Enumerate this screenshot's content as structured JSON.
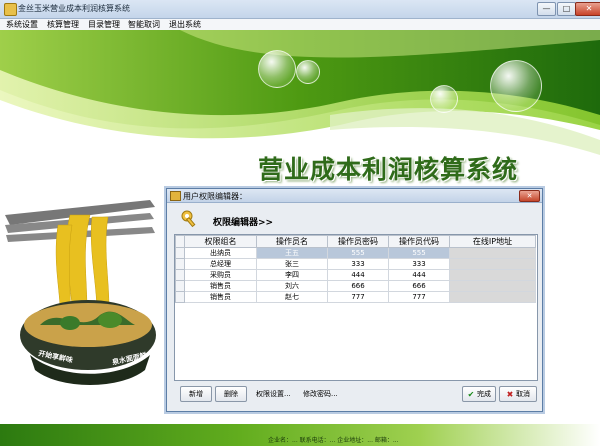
{
  "window": {
    "title": "金丝玉米营业成本利润核算系统",
    "minimize_glyph": "—",
    "maximize_glyph": "□",
    "close_glyph": "✕"
  },
  "menu": [
    "系统设置",
    "核算管理",
    "目录管理",
    "智能取词",
    "退出系统"
  ],
  "banner": {
    "title": "营业成本利润核算系统",
    "bowl_text_left": "开始享鲜味",
    "bowl_text_right": "泉水面面鲜"
  },
  "dialog": {
    "title": "用户权限编辑器：",
    "close_glyph": "✕",
    "editor_label": "权限编辑器>>",
    "columns": [
      "权限组名",
      "操作员名",
      "操作员密码",
      "操作员代码",
      "在线IP地址"
    ],
    "rows": [
      [
        "出纳员",
        "王五",
        "555",
        "555",
        ""
      ],
      [
        "总经理",
        "张三",
        "333",
        "333",
        ""
      ],
      [
        "采购员",
        "李四",
        "444",
        "444",
        ""
      ],
      [
        "销售员",
        "刘六",
        "666",
        "666",
        ""
      ],
      [
        "销售员",
        "赵七",
        "777",
        "777",
        ""
      ]
    ],
    "buttons": {
      "add": "新增",
      "delete": "删除",
      "permission_settings": "权限设置...",
      "change_password": "修改密码...",
      "done": "完成",
      "cancel": "取消"
    }
  },
  "status": {
    "text": "企业名：...  联系电话：...  企业地址：...  邮箱：..."
  },
  "colors": {
    "title_green": "#2f6b1a",
    "banner_green": "#4e9a12",
    "selected_row": "#b8c7da"
  }
}
